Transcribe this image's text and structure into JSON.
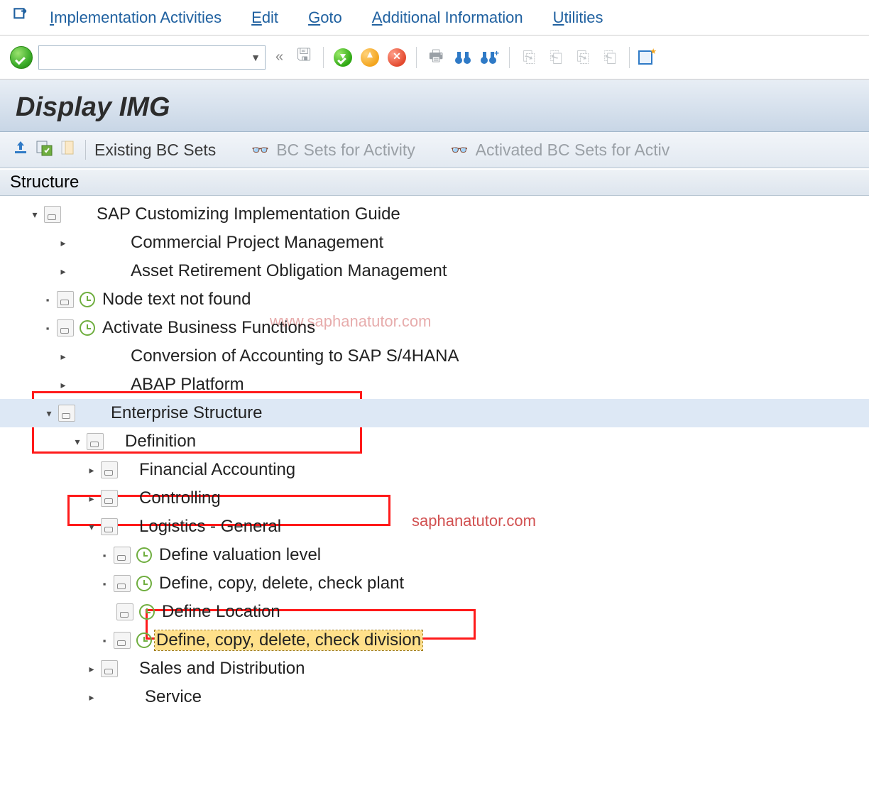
{
  "menu": {
    "items": [
      {
        "prefix": "I",
        "rest": "mplementation Activities"
      },
      {
        "prefix": "E",
        "rest": "dit"
      },
      {
        "prefix": "G",
        "rest": "oto"
      },
      {
        "prefix": "A",
        "rest": "dditional Information"
      },
      {
        "prefix": "U",
        "rest": "tilities"
      }
    ]
  },
  "toolbar": {
    "ok_tooltip": "Enter",
    "combo_value": ""
  },
  "title": "Display IMG",
  "sub_toolbar": {
    "existing_bc_sets": "Existing BC Sets",
    "bc_sets_activity": "BC Sets for Activity",
    "activated_bc_sets": "Activated BC Sets for Activ"
  },
  "structure_header": "Structure",
  "tree": {
    "root": "SAP Customizing Implementation Guide",
    "items": [
      "Commercial Project Management",
      "Asset Retirement Obligation Management",
      "Node text not found",
      "Activate Business Functions",
      "Conversion of Accounting to SAP S/4HANA",
      "ABAP Platform"
    ],
    "enterprise": "Enterprise Structure",
    "definition": "Definition",
    "def_children": [
      "Financial Accounting",
      "Controlling"
    ],
    "logistics": "Logistics - General",
    "log_children": [
      "Define valuation level",
      "Define, copy, delete, check plant",
      "Define Location",
      "Define, copy, delete, check division"
    ],
    "after": [
      "Sales and Distribution",
      "Service"
    ]
  },
  "watermarks": {
    "w1": "www.saphanatutor.com",
    "w2": "saphanatutor.com"
  }
}
